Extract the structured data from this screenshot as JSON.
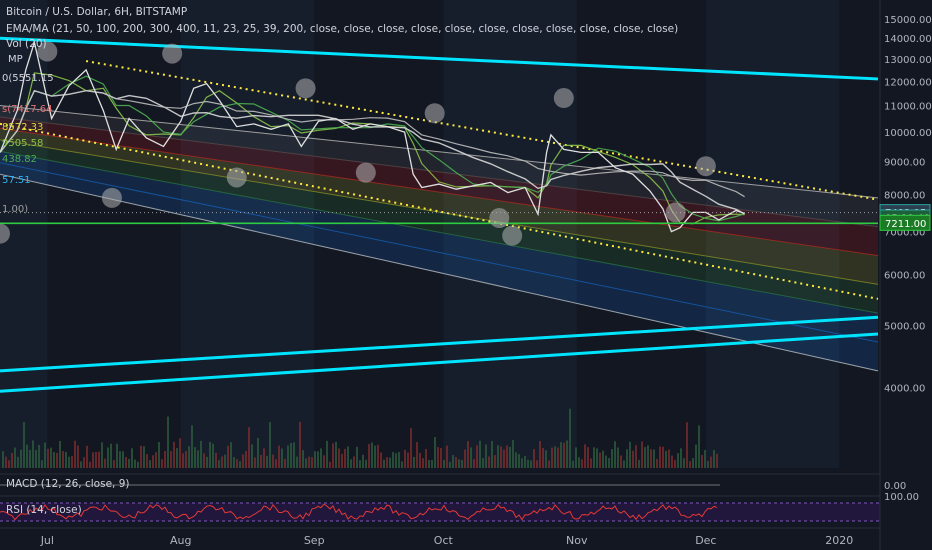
{
  "header": {
    "title": "Bitcoin / U.S. Dollar, 6H, BITSTAMP",
    "ma_legend": "EMA/MA (21, 50, 100, 200, 300, 400, 11, 23, 25, 39, 200, close, close, close, close, close, close, close, close, close, close, close)",
    "vol_legend": "Vol (20)",
    "mp_label": "MP"
  },
  "indicator_labels": [
    "0(5551.15",
    "s(7417.64",
    "8572.33",
    "9505.58",
    "438.82",
    "57.51",
    "1.00)"
  ],
  "price_badges": [
    {
      "label": "7492.95",
      "value": 7492.95,
      "bg": "#2c3e50",
      "border": "#26a69a"
    },
    {
      "label": "05:19:40",
      "value": 7350,
      "bg": "#1e5f3a",
      "border": "#26a69a"
    },
    {
      "label": "7211.00",
      "value": 7211,
      "bg": "#1b7a24",
      "border": "#2ecc40"
    }
  ],
  "panes": {
    "macd": {
      "label": "MACD (12, 26, close, 9)",
      "axis_label": "0.00"
    },
    "rsi": {
      "label": "RSI (14, close)",
      "axis_label": "100.00"
    }
  },
  "chart_data": {
    "type": "line",
    "title": "Bitcoin / U.S. Dollar, 6H, BITSTAMP",
    "xlabel": "",
    "ylabel": "",
    "y_scale": "log",
    "ylim": [
      3000,
      15000
    ],
    "x_range": [
      "2019-06-20",
      "2020-01-10"
    ],
    "x_ticks": [
      {
        "label": "Jul",
        "date": "2019-07-01"
      },
      {
        "label": "Aug",
        "date": "2019-08-01"
      },
      {
        "label": "Sep",
        "date": "2019-09-01"
      },
      {
        "label": "Oct",
        "date": "2019-10-01"
      },
      {
        "label": "Nov",
        "date": "2019-11-01"
      },
      {
        "label": "Dec",
        "date": "2019-12-01"
      },
      {
        "label": "2020",
        "date": "2020-01-01"
      }
    ],
    "y_ticks": [
      {
        "label": "15000.00",
        "value": 15000
      },
      {
        "label": "14000.00",
        "value": 14000
      },
      {
        "label": "13000.00",
        "value": 13000
      },
      {
        "label": "12000.00",
        "value": 12000
      },
      {
        "label": "11000.00",
        "value": 11000
      },
      {
        "label": "10000.00",
        "value": 10000
      },
      {
        "label": "9000.00",
        "value": 9000
      },
      {
        "label": "8000.00",
        "value": 8000
      },
      {
        "label": "7000.00",
        "value": 7000
      },
      {
        "label": "6000.00",
        "value": 6000
      },
      {
        "label": "5000.00",
        "value": 5000
      },
      {
        "label": "4000.00",
        "value": 4000
      }
    ],
    "price": {
      "dates": [
        "2019-06-20",
        "2019-06-24",
        "2019-06-26",
        "2019-06-28",
        "2019-07-02",
        "2019-07-06",
        "2019-07-10",
        "2019-07-14",
        "2019-07-17",
        "2019-07-20",
        "2019-07-24",
        "2019-07-28",
        "2019-08-01",
        "2019-08-04",
        "2019-08-07",
        "2019-08-10",
        "2019-08-14",
        "2019-08-18",
        "2019-08-22",
        "2019-08-26",
        "2019-08-29",
        "2019-09-02",
        "2019-09-06",
        "2019-09-10",
        "2019-09-14",
        "2019-09-18",
        "2019-09-22",
        "2019-09-24",
        "2019-09-26",
        "2019-09-30",
        "2019-10-04",
        "2019-10-08",
        "2019-10-12",
        "2019-10-16",
        "2019-10-20",
        "2019-10-23",
        "2019-10-25",
        "2019-10-26",
        "2019-10-29",
        "2019-11-02",
        "2019-11-06",
        "2019-11-10",
        "2019-11-14",
        "2019-11-18",
        "2019-11-21",
        "2019-11-23",
        "2019-11-25",
        "2019-11-28",
        "2019-12-01",
        "2019-12-04",
        "2019-12-08",
        "2019-12-10"
      ],
      "values": [
        9300,
        10800,
        12500,
        13800,
        10500,
        11800,
        12500,
        10800,
        9400,
        10500,
        9800,
        9500,
        10400,
        11700,
        11900,
        11200,
        10200,
        10300,
        10100,
        10300,
        9500,
        10400,
        10500,
        10100,
        10300,
        10200,
        10000,
        8600,
        8200,
        8300,
        8150,
        8250,
        8350,
        8050,
        8200,
        7450,
        9300,
        9900,
        9400,
        9300,
        9300,
        8800,
        8600,
        8100,
        7600,
        7000,
        7100,
        7500,
        7500,
        7300,
        7550,
        7470
      ]
    },
    "bands": {
      "upper_start": {
        "date": "2019-06-20",
        "value": 11000
      },
      "upper_end": {
        "date": "2020-01-10",
        "value": 7900
      },
      "lower_start": {
        "date": "2019-06-20",
        "value": 8600
      },
      "lower_end": {
        "date": "2020-01-10",
        "value": 4250
      },
      "dotted_upper_start": {
        "date": "2019-07-10",
        "value": 12900
      },
      "dotted_upper_end": {
        "date": "2020-01-10",
        "value": 7850
      },
      "dotted_lower_start": {
        "date": "2019-06-20",
        "value": 10300
      },
      "dotted_lower_end": {
        "date": "2020-01-10",
        "value": 5500
      }
    },
    "trendlines": [
      {
        "start": {
          "date": "2019-06-20",
          "value": 14000
        },
        "end": {
          "date": "2020-01-10",
          "value": 12100
        }
      },
      {
        "start": {
          "date": "2019-06-20",
          "value": 4250
        },
        "end": {
          "date": "2020-01-10",
          "value": 5150
        }
      },
      {
        "start": {
          "date": "2019-06-20",
          "value": 3950
        },
        "end": {
          "date": "2020-01-10",
          "value": 4850
        }
      }
    ],
    "horizontal_level": 7211,
    "current_price": 7492.95,
    "circle_markers": [
      {
        "date": "2019-07-01",
        "value": 13350
      },
      {
        "date": "2019-07-30",
        "value": 13250
      },
      {
        "date": "2019-08-30",
        "value": 11700
      },
      {
        "date": "2019-09-29",
        "value": 10700
      },
      {
        "date": "2019-10-29",
        "value": 11300
      },
      {
        "date": "2019-12-01",
        "value": 8850
      },
      {
        "date": "2019-07-16",
        "value": 7900
      },
      {
        "date": "2019-08-14",
        "value": 8500
      },
      {
        "date": "2019-09-13",
        "value": 8650
      },
      {
        "date": "2019-10-14",
        "value": 7350
      },
      {
        "date": "2019-11-24",
        "value": 7500
      },
      {
        "date": "2019-06-20",
        "value": 6950
      },
      {
        "date": "2019-10-17",
        "value": 6900
      }
    ]
  },
  "colors": {
    "background": "#131722",
    "trendline": "#00e5ff",
    "horizontal_level": "#2ecc40",
    "dotted_lines": "#ffeb3b",
    "price_line": "#e0e0e0",
    "ma_white": "#d8d8d8",
    "ma_green": "#4caf50",
    "ma_light_green": "#8bc34a",
    "red_zone": "#b71c1c",
    "yellow_zone": "#9e9d24",
    "green_zone": "#2e7d32",
    "blue_zone": "#1565c0",
    "grey_zone": "#555555"
  }
}
